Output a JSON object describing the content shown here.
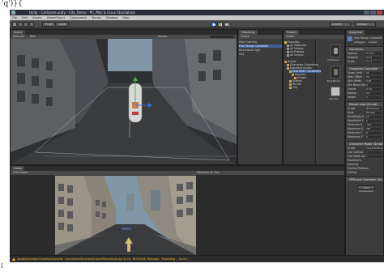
{
  "caption": {
    "top_text": "'q')}{",
    "bottom_mark": "I"
  },
  "window": {
    "title": "Unity - CarScene.unity - City_Demo - PC, Mac & Linux Standalone"
  },
  "menu": [
    "File",
    "Edit",
    "Assets",
    "GameObject",
    "Component",
    "Terrain",
    "Window",
    "Help"
  ],
  "toolbar": {
    "pivot_label": "Pivot",
    "local_label": "Local",
    "layers_label": "Layers",
    "layout_label": "Layout"
  },
  "scene": {
    "tab": "Scene",
    "shading": "Textured",
    "mode": "RGB",
    "gizmos": "Gizmos"
  },
  "game": {
    "tab": "Game",
    "aspect": "Free Aspect",
    "maximize": "Maximize on Play"
  },
  "hierarchy": {
    "tab": "Hierarchy",
    "create": "Create",
    "items": [
      "Main Camera",
      "First Person Controller",
      "Directional light",
      "City"
    ]
  },
  "project": {
    "tab": "Project",
    "create": "Create",
    "tree": [
      "Favorites",
      "All Materials",
      "All Models",
      "All Prefabs",
      "All Scripts",
      "Assets",
      "Character Controllers",
      "Standard Assets",
      "Character Controllers",
      "Sources",
      "Scripts",
      "Scenes",
      "Terrain",
      "City"
    ],
    "thumbs": [
      "3rd Person",
      "First Person",
      "Sources"
    ]
  },
  "inspector": {
    "tab": "Inspector",
    "object_name": "First Person Controller",
    "tag": "Untagged",
    "layer": "Default",
    "transform": "Transform",
    "rows": [
      {
        "label": "Position",
        "value": "0  1.5  0"
      },
      {
        "label": "Rotation",
        "value": "0  0  0"
      },
      {
        "label": "Scale",
        "value": "1  1  1"
      }
    ],
    "char_ctrl": "Character Controller",
    "cc_rows": [
      {
        "label": "Slope Limit",
        "value": "45"
      },
      {
        "label": "Step Offset",
        "value": "0.4"
      },
      {
        "label": "Skin Width",
        "value": "0.08"
      },
      {
        "label": "Min Move Distance",
        "value": "0"
      },
      {
        "label": "Center",
        "value": "0  0  0"
      },
      {
        "label": "Radius",
        "value": "0.4"
      },
      {
        "label": "Height",
        "value": "2"
      }
    ],
    "mouse_look": "Mouse Look (Script)",
    "ml_rows": [
      {
        "label": "Script",
        "value": "MouseLook"
      },
      {
        "label": "Axes",
        "value": "MouseX"
      },
      {
        "label": "Sensitivity X",
        "value": "15"
      },
      {
        "label": "Sensitivity Y",
        "value": "0"
      },
      {
        "label": "Minimum X",
        "value": "-360"
      },
      {
        "label": "Maximum X",
        "value": "360"
      },
      {
        "label": "Minimum Y",
        "value": "0"
      },
      {
        "label": "Maximum Y",
        "value": "0"
      }
    ],
    "motor": "Character Motor (Script)",
    "motor_rows": [
      {
        "label": "Script",
        "value": "CharacterMotor"
      },
      {
        "label": "Can Control",
        "value": "✓"
      },
      {
        "label": "Use Fixed Update",
        "value": "✓"
      },
      {
        "label": "Movement",
        "value": ""
      },
      {
        "label": "Jumping",
        "value": ""
      },
      {
        "label": "Moving Platform",
        "value": ""
      },
      {
        "label": "Sliding",
        "value": ""
      }
    ],
    "fps_input": "FPSInput Controller (Script)",
    "add_component": "Add Component"
  },
  "status": {
    "message": "Assets/Standard Assets/Character Controllers/Sources/Scripts/MouseLook.js(18,14): BCE0044: Message: 'Expecting :, found ;'"
  },
  "colors": {
    "sky": "#7f97a8",
    "road": "#3a3b3d",
    "accent": "#3e5f96",
    "warning": "#f0c030"
  }
}
